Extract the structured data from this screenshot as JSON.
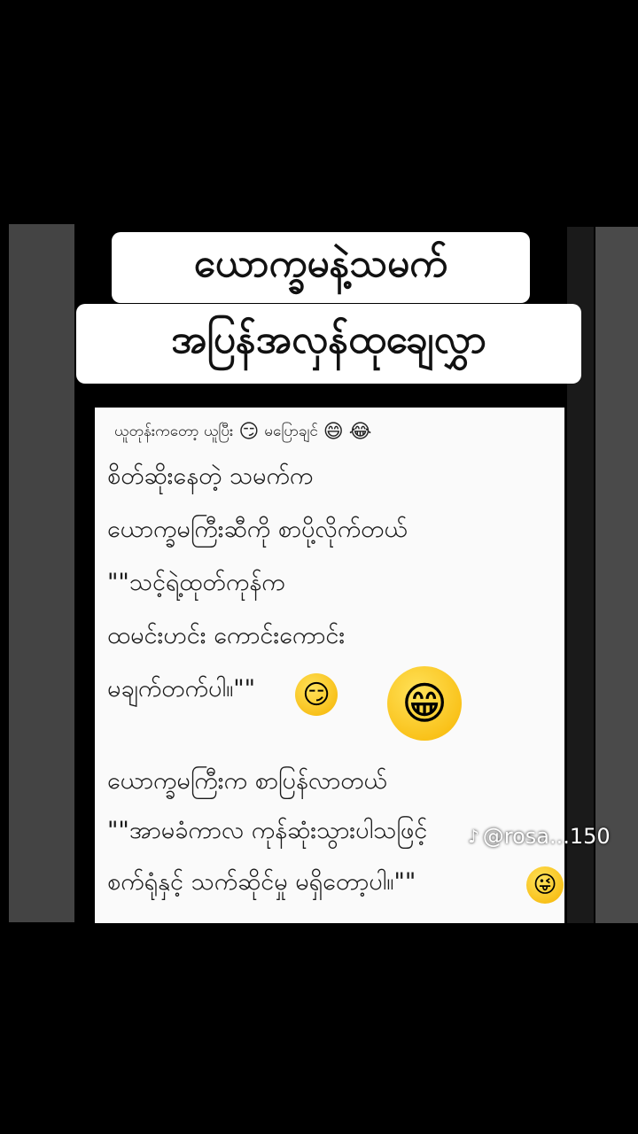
{
  "title": {
    "line1": "ယောက္ခမနဲ့သမက်",
    "line2": "အပြန်အလှန်ထုချေလွှာ"
  },
  "post": {
    "header_text": "ယူတုန်းကတော့ ယူပြီး",
    "header_text2": "မပြောချင်",
    "header_emoji1": "😏",
    "header_emoji2": "😄",
    "header_emoji3": "😂",
    "lines": [
      "စိတ်ဆိုးနေတဲ့ သမက်က",
      "ယောက္ခမကြီးဆီကို စာပို့လိုက်တယ်",
      "\"\"သင့်ရဲ့ထုတ်ကုန်က",
      "ထမင်းဟင်း ကောင်းကောင်း",
      "မချက်တက်ပါ။\"\"",
      "ယောက္ခမကြီးက စာပြန်လာတယ်",
      "\"\"အာမခံကာလ ကုန်ဆုံးသွားပါသဖြင့်",
      "စက်ရုံနှင့် သက်ဆိုင်မှု မရှိတော့ပါ။\"\""
    ],
    "emoji_smirk": "😏",
    "emoji_grin": "😁",
    "emoji_tongue": "😜"
  },
  "watermark": {
    "icon": "tiktok-icon",
    "text": "@rosa...150"
  }
}
